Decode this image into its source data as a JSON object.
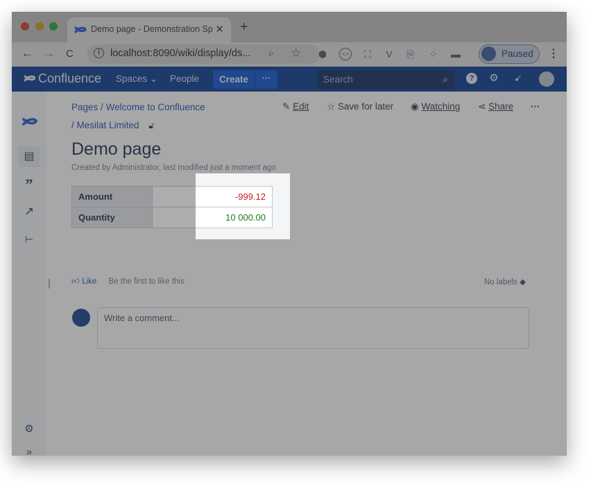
{
  "browser": {
    "tab_title": "Demo page - Demonstration Sp",
    "tab_close": "✕",
    "new_tab": "+",
    "url": "localhost:8090/wiki/display/ds...",
    "profile_label": "Paused"
  },
  "header": {
    "brand": "Confluence",
    "nav": {
      "spaces": "Spaces ⌄",
      "people": "People"
    },
    "create": "Create",
    "more": "···",
    "search_placeholder": "Search"
  },
  "breadcrumb": {
    "pages": "Pages",
    "separator": "/",
    "welcome": "Welcome to Confluence",
    "mesilat": "Mesilat Limited"
  },
  "actions": {
    "edit": "Edit",
    "save_for_later": "Save for later",
    "watching": "Watching",
    "share": "Share",
    "more": "···"
  },
  "page": {
    "title": "Demo page",
    "byline": "Created by Administrator, last modified just a moment ago"
  },
  "table": {
    "rows": [
      {
        "label": "Amount",
        "value": "-999.12",
        "color": "#cc1f1f"
      },
      {
        "label": "Quantity",
        "value": "10 000.00",
        "color": "#1b7a1b"
      }
    ]
  },
  "footer": {
    "like": "Like",
    "be_first": "Be the first to like this",
    "no_labels": "No labels",
    "comment_placeholder": "Write a comment..."
  },
  "icons": {
    "tab_favicon": "confluence-logo-icon",
    "back": "←",
    "forward": "→",
    "reload": "C",
    "search": "⌕",
    "star": "☆",
    "kebab": "⋮"
  }
}
